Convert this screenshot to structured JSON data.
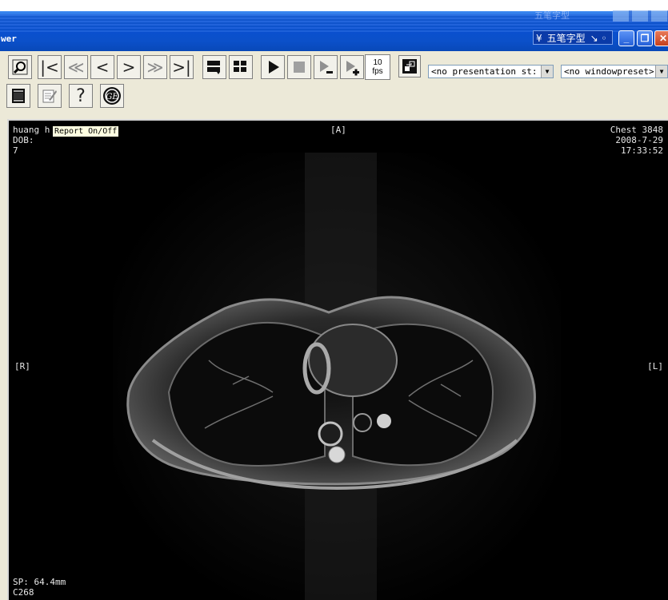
{
  "window": {
    "title": "wer",
    "ime_label": "五笔字型",
    "ime_extra": "↘ ◦",
    "ime_ghost": "五笔字型",
    "min_glyph": "_",
    "max_glyph": "❐",
    "close_glyph": "✕"
  },
  "toolbar": {
    "fps_value": "10",
    "fps_unit": "fps",
    "presentation_state": "<no presentation st:",
    "window_preset": "<no windowpreset>",
    "combo_arrow": "▼"
  },
  "tooltip": "Report On/Off",
  "overlay": {
    "patient_name": "huang h",
    "dob_label": "DOB:",
    "patient_line3": "7",
    "top_center": "[A]",
    "study_desc": "Chest 3848",
    "study_date": "2008-7-29",
    "study_time": "17:33:52",
    "left_orient": "[R]",
    "right_orient": "[L]",
    "slice_position": "SP: 64.4mm",
    "contrast": "C268"
  },
  "icons": {
    "zoom": "magnifier-icon",
    "first": "first-frame-icon",
    "rewind": "fast-rewind-icon",
    "prev": "previous-frame-icon",
    "next": "next-frame-icon",
    "ffwd": "fast-forward-icon",
    "last": "last-frame-icon",
    "layout1": "layout-icon",
    "layout2": "tile-layout-icon",
    "play": "play-icon",
    "stop": "stop-icon",
    "slower": "slower-icon",
    "faster": "faster-icon",
    "sync": "sync-icon",
    "report": "report-icon",
    "notes": "notes-icon",
    "help": "help-icon",
    "ge": "ge-logo-icon"
  },
  "colors": {
    "titlebar": "#0a4fd0",
    "toolbar_bg": "#ece9d8",
    "viewer_bg": "#000000"
  }
}
